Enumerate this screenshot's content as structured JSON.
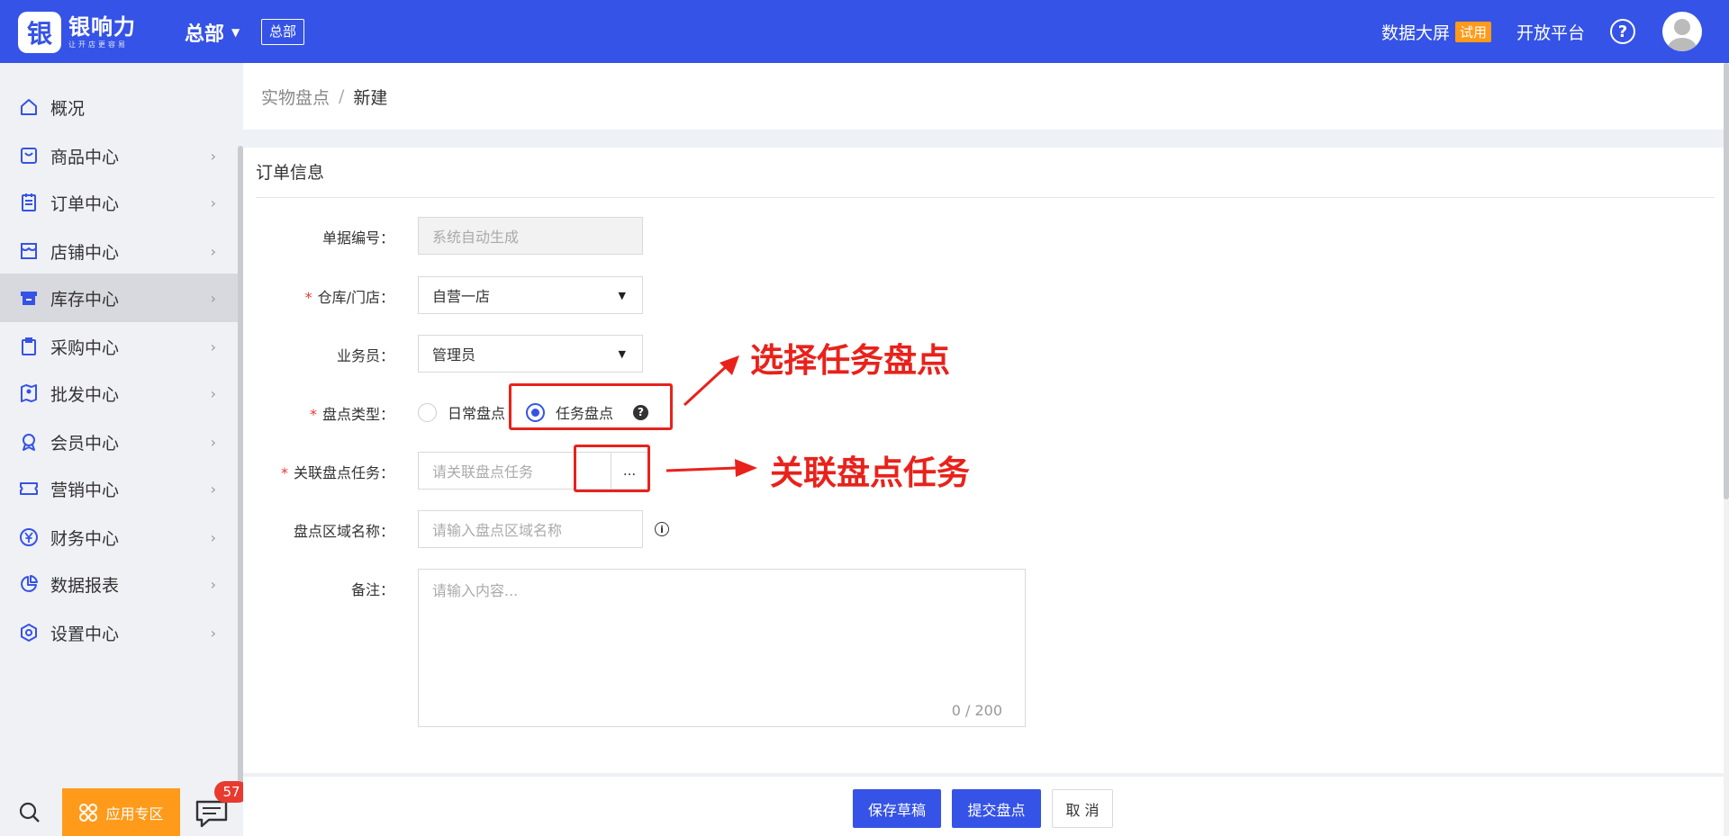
{
  "app": {
    "logo_glyph": "银",
    "name": "银响力",
    "tagline": "让开店更容易",
    "org_name": "总部",
    "org_tag": "总部"
  },
  "topbar": {
    "data_screen": "数据大屏",
    "trial_badge": "试用",
    "open_platform": "开放平台",
    "help": "?"
  },
  "sidebar": {
    "items": [
      {
        "label": "概况",
        "icon": "home-icon"
      },
      {
        "label": "商品中心",
        "icon": "bag-icon"
      },
      {
        "label": "订单中心",
        "icon": "clipboard-icon"
      },
      {
        "label": "店铺中心",
        "icon": "store-icon"
      },
      {
        "label": "库存中心",
        "icon": "box-icon"
      },
      {
        "label": "采购中心",
        "icon": "purchase-icon"
      },
      {
        "label": "批发中心",
        "icon": "map-pin-icon"
      },
      {
        "label": "会员中心",
        "icon": "member-icon"
      },
      {
        "label": "营销中心",
        "icon": "ticket-icon"
      },
      {
        "label": "财务中心",
        "icon": "yuan-icon"
      },
      {
        "label": "数据报表",
        "icon": "pie-chart-icon"
      },
      {
        "label": "设置中心",
        "icon": "settings-icon"
      }
    ],
    "active_index": 4,
    "apps_button": "应用专区",
    "message_count": "57"
  },
  "breadcrumb": {
    "parent": "实物盘点",
    "separator": "/",
    "current": "新建"
  },
  "form": {
    "section_title": "订单信息",
    "doc_no": {
      "label": "单据编号",
      "placeholder": "系统自动生成"
    },
    "warehouse": {
      "label": "仓库/门店",
      "value": "自营一店"
    },
    "salesperson": {
      "label": "业务员",
      "value": "管理员"
    },
    "count_type": {
      "label": "盘点类型",
      "options": [
        "日常盘点",
        "任务盘点"
      ],
      "selected": "任务盘点"
    },
    "related_task": {
      "label": "关联盘点任务",
      "placeholder": "请关联盘点任务",
      "button": "..."
    },
    "area_name": {
      "label": "盘点区域名称",
      "placeholder": "请输入盘点区域名称"
    },
    "remark": {
      "label": "备注",
      "placeholder": "请输入内容...",
      "counter": "0 / 200"
    }
  },
  "annotations": {
    "select_task": "选择任务盘点",
    "link_task": "关联盘点任务"
  },
  "footer": {
    "save_draft": "保存草稿",
    "submit": "提交盘点",
    "cancel": "取 消"
  }
}
